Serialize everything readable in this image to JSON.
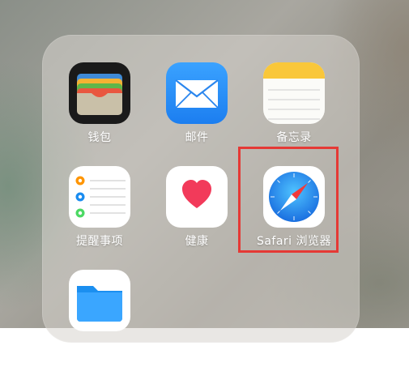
{
  "apps": [
    {
      "label": "钱包",
      "icon": "wallet-icon"
    },
    {
      "label": "邮件",
      "icon": "mail-icon"
    },
    {
      "label": "备忘录",
      "icon": "notes-icon"
    },
    {
      "label": "提醒事项",
      "icon": "reminders-icon"
    },
    {
      "label": "健康",
      "icon": "health-icon"
    },
    {
      "label": "Safari 浏览器",
      "icon": "safari-icon"
    },
    {
      "label": "",
      "icon": "files-icon"
    }
  ],
  "colors": {
    "highlight": "#e53935",
    "mail_bg": "#2f8ff5",
    "health_heart": "#f23a5a",
    "safari_blue": "#1a8cf0",
    "files_blue": "#1b8ff0",
    "notes_yellow": "#f9c73a"
  }
}
